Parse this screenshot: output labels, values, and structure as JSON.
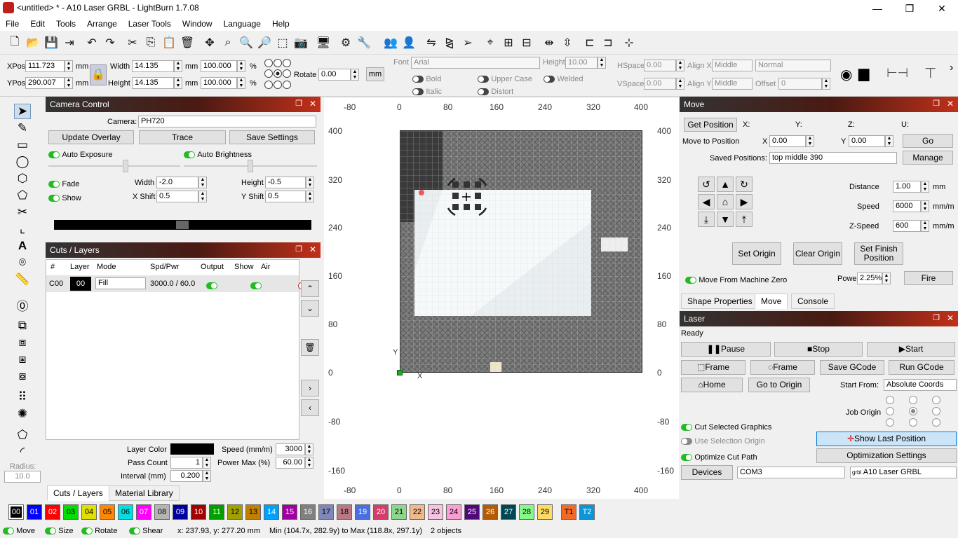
{
  "window": {
    "title": "<untitled> * - A10 Laser GRBL - LightBurn 1.7.08",
    "minimize": "—",
    "maximize": "❐",
    "close": "✕"
  },
  "menu": [
    "File",
    "Edit",
    "Tools",
    "Arrange",
    "Laser Tools",
    "Window",
    "Language",
    "Help"
  ],
  "props": {
    "xpos_label": "XPos",
    "xpos": "111.723",
    "ypos_label": "YPos",
    "ypos": "290.007",
    "mm": "mm",
    "width_label": "Width",
    "width": "14.135",
    "height_label": "Height",
    "height": "14.135",
    "wpct": "100.000",
    "hpct": "100.000",
    "pct": "%",
    "rotate_label": "Rotate",
    "rotate": "0.00",
    "mm_btn": "mm",
    "font_label": "Font",
    "font": "Arial",
    "fheight_label": "Height",
    "fheight": "10.00",
    "hspace_label": "HSpace",
    "hspace": "0.00",
    "vspace_label": "VSpace",
    "vspace": "0.00",
    "alignx_label": "Align X",
    "alignx": "Middle",
    "aligny_label": "Align Y",
    "aligny": "Middle",
    "normal": "Normal",
    "offset_label": "Offset",
    "offset": "0",
    "bold": "Bold",
    "italic": "Italic",
    "upper": "Upper Case",
    "distort": "Distort",
    "welded": "Welded"
  },
  "camera": {
    "title": "Camera Control",
    "camera_label": "Camera:",
    "camera": "PH720",
    "update": "Update Overlay",
    "trace": "Trace",
    "save": "Save Settings",
    "auto_exp": "Auto Exposure",
    "auto_bright": "Auto Brightness",
    "fade": "Fade",
    "show": "Show",
    "width_label": "Width",
    "width": "-2.0",
    "height_label": "Height",
    "height": "-0.5",
    "xshift_label": "X Shift",
    "xshift": "0.5",
    "yshift_label": "Y Shift",
    "yshift": "0.5"
  },
  "layers": {
    "title": "Cuts / Layers",
    "cols": [
      "#",
      "Layer",
      "Mode",
      "Spd/Pwr",
      "Output",
      "Show",
      "Air"
    ],
    "row": {
      "num": "C00",
      "layer": "00",
      "mode": "Fill",
      "spd": "3000.0 / 60.0"
    },
    "layer_color_label": "Layer Color",
    "speed_label": "Speed (mm/m)",
    "speed": "3000",
    "pass_label": "Pass Count",
    "pass": "1",
    "power_label": "Power Max (%)",
    "power": "60.00",
    "interval_label": "Interval (mm)",
    "interval": "0.200",
    "tab1": "Cuts / Layers",
    "tab2": "Material Library"
  },
  "left_radius": {
    "label": "Radius:",
    "value": "10.0"
  },
  "ruler": {
    "top": [
      "-80",
      "0",
      "80",
      "160",
      "240",
      "320",
      "400"
    ],
    "bottom": [
      "-80",
      "0",
      "80",
      "160",
      "240",
      "320",
      "400"
    ],
    "left": [
      "400",
      "320",
      "240",
      "160",
      "80",
      "0",
      "-80",
      "-160"
    ],
    "right": [
      "400",
      "320",
      "240",
      "160",
      "80",
      "0",
      "-80",
      "-160"
    ],
    "x": "X",
    "y": "Y"
  },
  "move": {
    "title": "Move",
    "get_pos": "Get Position",
    "x": "X:",
    "y": "Y:",
    "z": "Z:",
    "u": "U:",
    "move_to": "Move to Position",
    "mx_label": "X",
    "mx": "0.00",
    "my_label": "Y",
    "my": "0.00",
    "go": "Go",
    "saved_label": "Saved Positions:",
    "saved": "top middle 390",
    "manage": "Manage",
    "distance_label": "Distance",
    "distance": "1.00",
    "speed_label": "Speed",
    "speed": "6000",
    "zspeed_label": "Z-Speed",
    "zspeed": "600",
    "mm": "mm",
    "mmm": "mm/m",
    "set_origin": "Set Origin",
    "clear_origin": "Clear Origin",
    "set_finish": "Set Finish Position",
    "from_zero": "Move From Machine Zero",
    "power_label": "Power",
    "power": "2.25%",
    "fire": "Fire",
    "tabs": [
      "Shape Properties",
      "Move",
      "Console"
    ]
  },
  "laser": {
    "title": "Laser",
    "status": "Ready",
    "pause": "Pause",
    "stop": "Stop",
    "start": "Start",
    "frame1": "Frame",
    "frame2": "Frame",
    "save_gcode": "Save GCode",
    "run_gcode": "Run GCode",
    "home": "Home",
    "go_origin": "Go to Origin",
    "start_from_label": "Start From:",
    "start_from": "Absolute Coords",
    "job_origin": "Job Origin",
    "cut_sel": "Cut Selected Graphics",
    "use_sel": "Use Selection Origin",
    "show_last": "Show Last Position",
    "optimize": "Optimize Cut Path",
    "opt_settings": "Optimization Settings",
    "devices": "Devices",
    "port": "COM3",
    "device": "A10 Laser GRBL",
    "grbl": "grbl"
  },
  "palette": [
    {
      "l": "00",
      "c": "#000000",
      "t": "#fff"
    },
    {
      "l": "01",
      "c": "#0000ff",
      "t": "#fff"
    },
    {
      "l": "02",
      "c": "#ff0000",
      "t": "#fff"
    },
    {
      "l": "03",
      "c": "#00e000",
      "t": "#000"
    },
    {
      "l": "04",
      "c": "#e0e000",
      "t": "#000"
    },
    {
      "l": "05",
      "c": "#ff8800",
      "t": "#000"
    },
    {
      "l": "06",
      "c": "#00e0e0",
      "t": "#000"
    },
    {
      "l": "07",
      "c": "#ff00ff",
      "t": "#fff"
    },
    {
      "l": "08",
      "c": "#b4b4b4",
      "t": "#000"
    },
    {
      "l": "09",
      "c": "#0000a0",
      "t": "#fff"
    },
    {
      "l": "10",
      "c": "#a00000",
      "t": "#fff"
    },
    {
      "l": "11",
      "c": "#00a000",
      "t": "#fff"
    },
    {
      "l": "12",
      "c": "#a0a000",
      "t": "#000"
    },
    {
      "l": "13",
      "c": "#c08000",
      "t": "#000"
    },
    {
      "l": "14",
      "c": "#00a0ff",
      "t": "#fff"
    },
    {
      "l": "15",
      "c": "#a000a0",
      "t": "#fff"
    },
    {
      "l": "16",
      "c": "#808080",
      "t": "#fff"
    },
    {
      "l": "17",
      "c": "#7d87b9",
      "t": "#000"
    },
    {
      "l": "18",
      "c": "#bb7784",
      "t": "#000"
    },
    {
      "l": "19",
      "c": "#4a6fe3",
      "t": "#fff"
    },
    {
      "l": "20",
      "c": "#d33f6a",
      "t": "#fff"
    },
    {
      "l": "21",
      "c": "#8cd78c",
      "t": "#000"
    },
    {
      "l": "22",
      "c": "#f0b98d",
      "t": "#000"
    },
    {
      "l": "23",
      "c": "#f6c4e1",
      "t": "#000"
    },
    {
      "l": "24",
      "c": "#fa9ed4",
      "t": "#000"
    },
    {
      "l": "25",
      "c": "#500a78",
      "t": "#fff"
    },
    {
      "l": "26",
      "c": "#b45a00",
      "t": "#fff"
    },
    {
      "l": "27",
      "c": "#004754",
      "t": "#fff"
    },
    {
      "l": "28",
      "c": "#86fa88",
      "t": "#000"
    },
    {
      "l": "29",
      "c": "#ffdb66",
      "t": "#000"
    },
    {
      "l": "T1",
      "c": "#f36926",
      "t": "#000"
    },
    {
      "l": "T2",
      "c": "#0c96d9",
      "t": "#fff"
    }
  ],
  "status": {
    "move": "Move",
    "size": "Size",
    "rotate": "Rotate",
    "shear": "Shear",
    "coords": "x: 237.93, y: 277.20 mm",
    "minmax": "Min (104.7x, 282.9y) to Max (118.8x, 297.1y)",
    "objects": "2 objects"
  }
}
